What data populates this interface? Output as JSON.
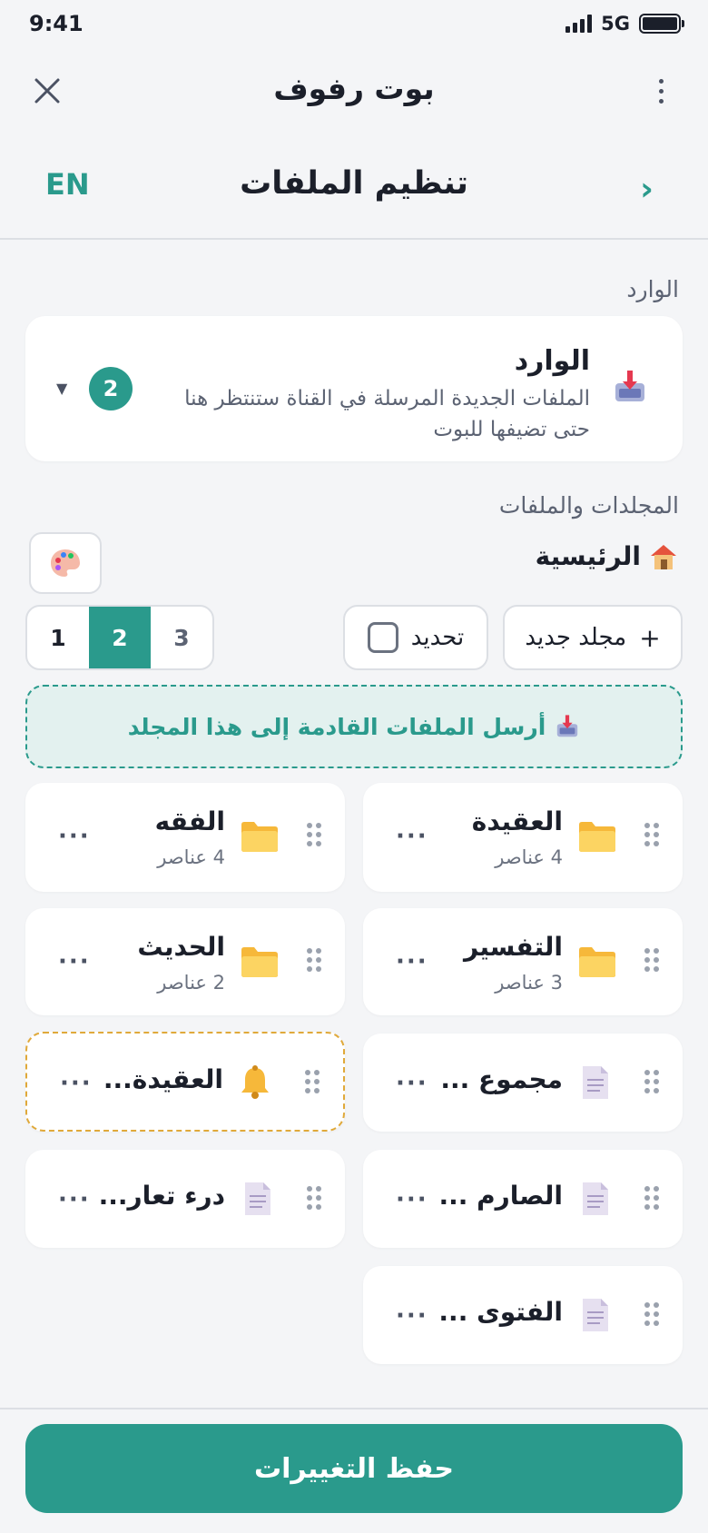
{
  "status": {
    "time": "9:41",
    "network": "5G"
  },
  "appbar": {
    "title": "بوت رفوف"
  },
  "subheader": {
    "title": "تنظيم الملفات",
    "lang": "EN"
  },
  "inbox": {
    "section_label": "الوارد",
    "title": "الوارد",
    "description": "الملفات الجديدة المرسلة في القناة ستنتظر هنا حتى تضيفها للبوت",
    "count": "2"
  },
  "folders": {
    "section_label": "المجلدات والملفات",
    "breadcrumb": "الرئيسية",
    "new_folder_label": "مجلد جديد",
    "new_folder_plus": "+",
    "select_label": "تحديد",
    "pages": [
      "1",
      "2",
      "3"
    ],
    "active_page": "2",
    "drop_zone_text": "أرسل الملفات القادمة إلى هذا المجلد"
  },
  "items": [
    {
      "title": "العقيدة",
      "sub": "4 عناصر",
      "type": "folder"
    },
    {
      "title": "الفقه",
      "sub": "4 عناصر",
      "type": "folder"
    },
    {
      "title": "التفسير",
      "sub": "3 عناصر",
      "type": "folder"
    },
    {
      "title": "الحديث",
      "sub": "2 عناصر",
      "type": "folder"
    },
    {
      "title": "مجموع ...",
      "type": "file"
    },
    {
      "title": "العقيدة...",
      "type": "bell"
    },
    {
      "title": "الصارم ...",
      "type": "file"
    },
    {
      "title": "درء تعار...",
      "type": "file"
    },
    {
      "title": "الفتوى ...",
      "type": "file"
    }
  ],
  "more_glyph": "···",
  "save_label": "حفظ التغييرات",
  "colors": {
    "accent": "#2a9a8c",
    "highlight": "#e0a93a",
    "background": "#f4f5f7"
  }
}
